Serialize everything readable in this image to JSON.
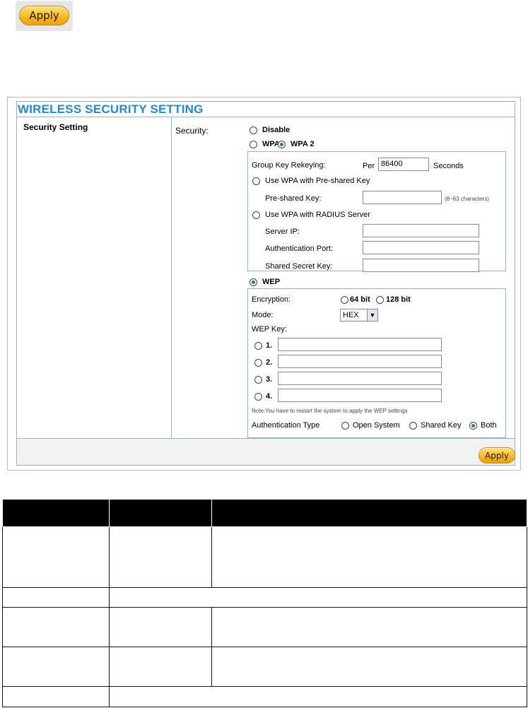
{
  "top_apply": {
    "label": "Apply"
  },
  "panel": {
    "title": "WIRELESS SECURITY SETTING",
    "left_label": "Security Setting",
    "security_label": "Security:",
    "options": {
      "disable": "Disable",
      "wpa": "WPA",
      "wpa2": "WPA 2",
      "wep": "WEP"
    },
    "wpa_box": {
      "group_key_label": "Group Key Rekeying:",
      "per_label": "Per",
      "rekey_value": "86400",
      "seconds_label": "Seconds",
      "psk_option": "Use WPA with Pre-shared Key",
      "psk_label": "Pre-shared Key:",
      "psk_value": "",
      "psk_hint": "(8~63 characters)",
      "radius_option": "Use WPA with RADIUS Server",
      "server_ip_label": "Server IP:",
      "server_ip_value": "",
      "auth_port_label": "Authentication Port:",
      "auth_port_value": "",
      "shared_secret_label": "Shared Secret Key:",
      "shared_secret_value": ""
    },
    "wep_box": {
      "encryption_label": "Encryption:",
      "enc_64": "64 bit",
      "enc_128": "128 bit",
      "mode_label": "Mode:",
      "mode_value": "HEX",
      "wep_key_label": "WEP Key:",
      "keys": [
        {
          "label": "1.",
          "value": ""
        },
        {
          "label": "2.",
          "value": ""
        },
        {
          "label": "3.",
          "value": ""
        },
        {
          "label": "4.",
          "value": ""
        }
      ],
      "note": "Note:You have to restart the system to apply the WEP settings",
      "auth_type_label": "Authentication Type",
      "auth_open": "Open System",
      "auth_shared": "Shared Key",
      "auth_both": "Both"
    },
    "apply_label": "Apply",
    "selected": {
      "security": "wep",
      "wpa_mode": "wpa2",
      "auth_type": "both"
    },
    "accent_color": "#1f8ad0"
  }
}
